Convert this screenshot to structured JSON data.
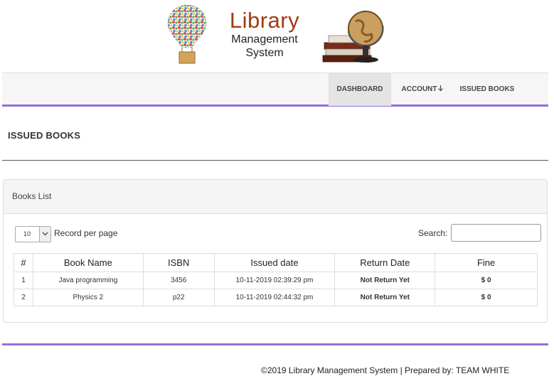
{
  "logo": {
    "title": "Library",
    "line1": "Management",
    "line2": "System"
  },
  "nav": {
    "dashboard": "DASHBOARD",
    "account": "ACCOUNT",
    "issued_books": "ISSUED BOOKS"
  },
  "page": {
    "title": "ISSUED BOOKS"
  },
  "panel": {
    "heading": "Books List",
    "length_value": "10",
    "length_label": "Record per page",
    "search_label": "Search:",
    "search_value": ""
  },
  "table": {
    "headers": [
      "#",
      "Book Name",
      "ISBN",
      "Issued date",
      "Return Date",
      "Fine"
    ],
    "rows": [
      {
        "num": "1",
        "book": "Java programming",
        "isbn": "3456",
        "issued": "10-11-2019 02:39:29 pm",
        "return": "Not Return Yet",
        "fine": "$ 0"
      },
      {
        "num": "2",
        "book": "Physics 2",
        "isbn": "p22",
        "issued": "10-11-2019 02:44:32 pm",
        "return": "Not Return Yet",
        "fine": "$ 0"
      }
    ]
  },
  "footer": {
    "text": "©2019 Library Management System | Prepared by: TEAM WHITE"
  },
  "colors": {
    "accent": "#9370db",
    "logo_red": "#a23a12",
    "not_returned": "#c9302c"
  }
}
